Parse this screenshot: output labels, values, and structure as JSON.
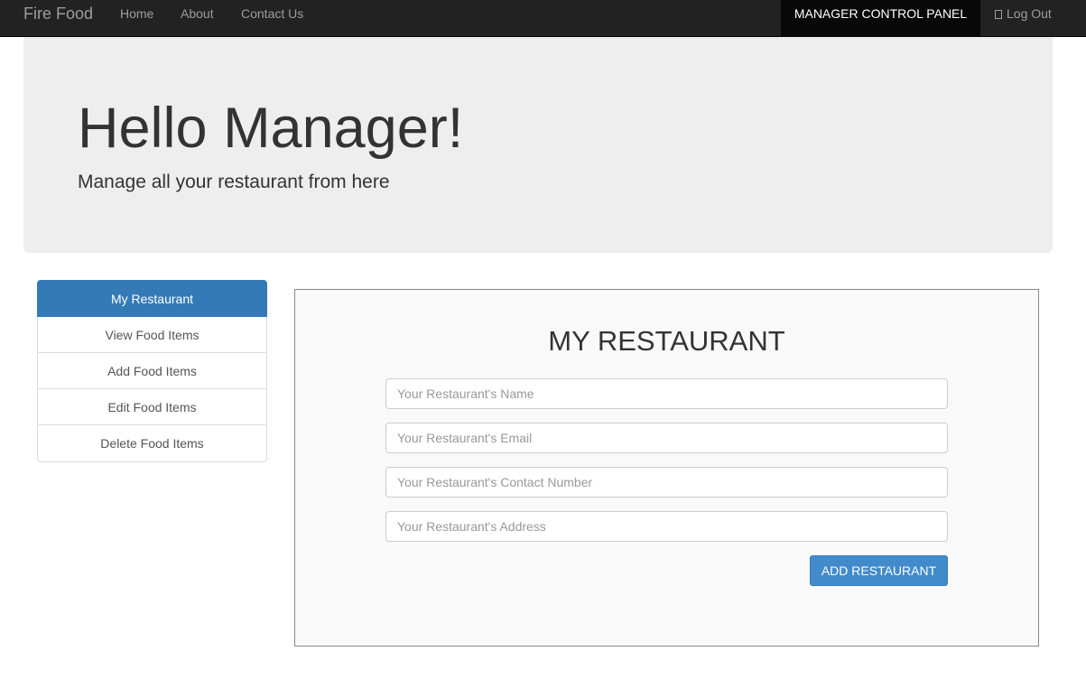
{
  "navbar": {
    "brand": "Fire Food",
    "links": [
      {
        "label": "Home"
      },
      {
        "label": "About"
      },
      {
        "label": "Contact Us"
      }
    ],
    "active_label": "MANAGER CONTROL PANEL",
    "logout_label": "Log Out",
    "logout_icon": "logout-icon"
  },
  "jumbotron": {
    "title": "Hello Manager!",
    "subtitle": "Manage all your restaurant from here"
  },
  "sidebar": {
    "items": [
      {
        "label": "My Restaurant",
        "active": true
      },
      {
        "label": "View Food Items",
        "active": false
      },
      {
        "label": "Add Food Items",
        "active": false
      },
      {
        "label": "Edit Food Items",
        "active": false
      },
      {
        "label": "Delete Food Items",
        "active": false
      }
    ]
  },
  "form": {
    "title": "MY RESTAURANT",
    "fields": [
      {
        "placeholder": "Your Restaurant's Name",
        "value": ""
      },
      {
        "placeholder": "Your Restaurant's Email",
        "value": ""
      },
      {
        "placeholder": "Your Restaurant's Contact Number",
        "value": ""
      },
      {
        "placeholder": "Your Restaurant's Address",
        "value": ""
      }
    ],
    "submit_label": "ADD RESTAURANT"
  },
  "colors": {
    "navbar_bg": "#222222",
    "active_nav_bg": "#080808",
    "primary": "#337ab7",
    "button": "#428bca",
    "jumbotron_bg": "#eeeeee"
  }
}
